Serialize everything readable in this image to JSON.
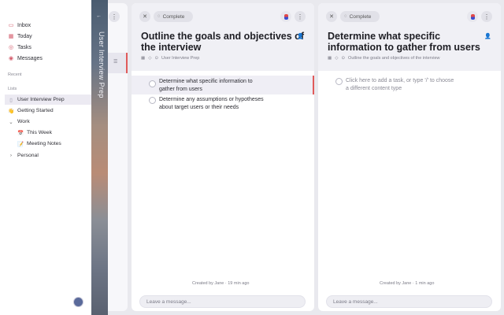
{
  "sidebar": {
    "nav": [
      {
        "label": "Inbox",
        "icon": "inbox-icon"
      },
      {
        "label": "Today",
        "icon": "calendar-icon"
      },
      {
        "label": "Tasks",
        "icon": "tasks-icon"
      },
      {
        "label": "Messages",
        "icon": "messages-icon"
      }
    ],
    "recent_label": "Recent",
    "lists_label": "Lists",
    "lists": [
      {
        "label": "User Interview Prep",
        "icon": "document-icon",
        "active": true
      },
      {
        "label": "Getting Started",
        "icon": "waving-hand-icon"
      },
      {
        "label": "Work",
        "icon": "chevron-down-icon"
      },
      {
        "label": "This Week",
        "icon": "calendar-emoji-icon"
      },
      {
        "label": "Meeting Notes",
        "icon": "memo-icon"
      },
      {
        "label": "Personal",
        "icon": "chevron-right-icon"
      }
    ]
  },
  "strip": {
    "title": "User Interview Prep"
  },
  "panels": [
    {
      "complete_label": "Complete",
      "title_line1": "Outline the goals and objectives of",
      "title_line2": "the interview",
      "breadcrumb": "User Interview Prep",
      "subtasks": [
        {
          "line1": "Determine what specific information to",
          "line2": "gather from users"
        },
        {
          "line1": "Determine any assumptions or hypotheses",
          "line2": "about target users or their needs"
        }
      ],
      "created": "Created by Jane  ·  19 min ago",
      "message_placeholder": "Leave a message..."
    },
    {
      "complete_label": "Complete",
      "title_line1": "Determine what specific",
      "title_line2": "information to gather from users",
      "breadcrumb": "Outline the goals and objectives of the interview",
      "placeholder_line1": "Click here to add a task, or type '/' to choose",
      "placeholder_line2": "a different content type",
      "created": "Created by Jane  ·  1 min ago",
      "message_placeholder": "Leave a message..."
    }
  ],
  "colors": {
    "accent": "#e05a5a",
    "background": "#e9e9ee"
  }
}
